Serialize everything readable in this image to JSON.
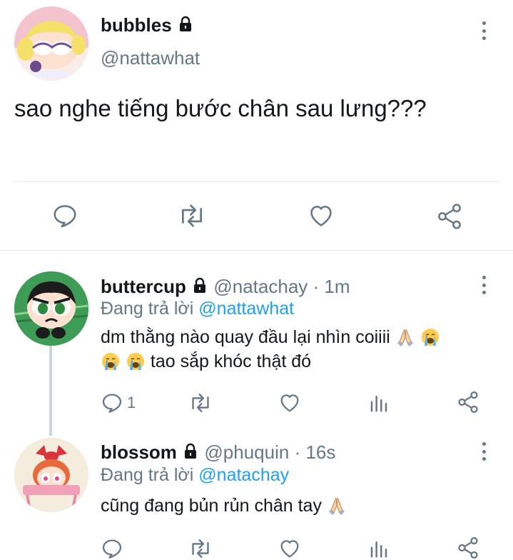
{
  "main_tweet": {
    "display_name": "bubbles",
    "handle": "@nattawhat",
    "text": "sao nghe tiếng bước chân sau lưng???",
    "avatar_icon": "bubbles-avatar",
    "actions": [
      "reply-icon",
      "retweet-icon",
      "like-icon",
      "share-icon"
    ]
  },
  "replies": [
    {
      "display_name": "buttercup",
      "handle": "@natachay",
      "separator": "·",
      "time": "1m",
      "replying_prefix": "Đang trả lời",
      "replying_to": "@nattawhat",
      "text_line1": "dm thằng nào quay đầu lại nhìn coiiii",
      "text_line2": "tao sắp khóc thật đó",
      "reply_count": "1"
    },
    {
      "display_name": "blossom",
      "handle": "@phuquin",
      "separator": "·",
      "time": "16s",
      "replying_prefix": "Đang trả lời",
      "replying_to": "@natachay",
      "text": "cũng đang bủn rủn chân tay",
      "reply_count": ""
    }
  ],
  "colors": {
    "text": "#14171a",
    "muted": "#657786",
    "link": "#1da1f2",
    "divider": "#e1e8ed",
    "thread_line": "#ccd6dd"
  }
}
